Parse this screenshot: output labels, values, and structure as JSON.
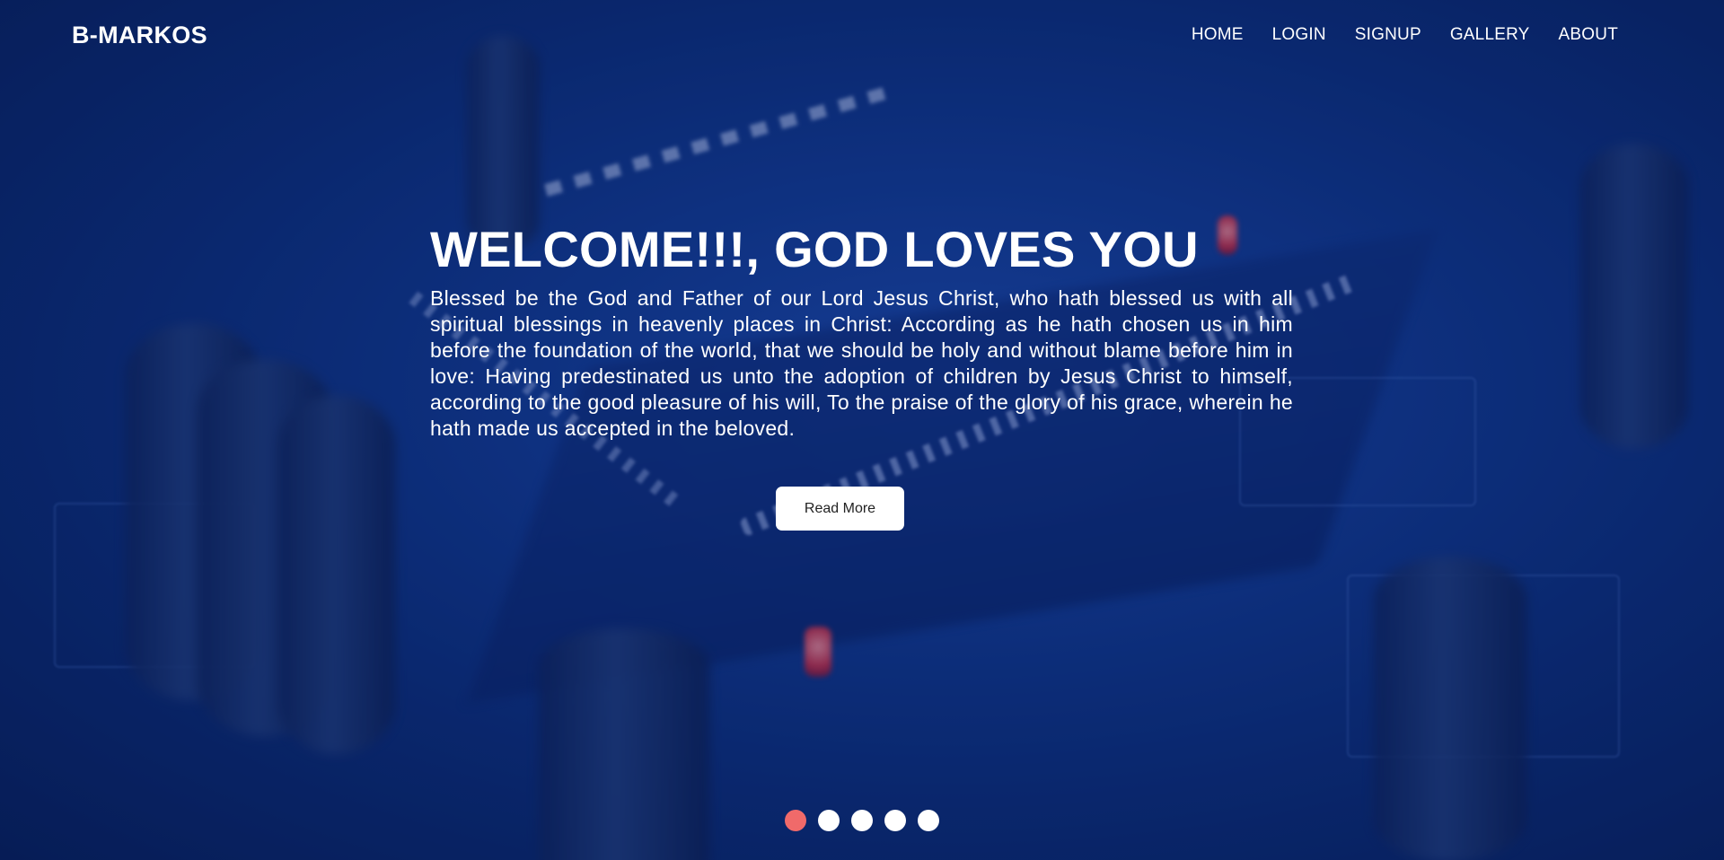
{
  "brand": "B-MARKOS",
  "nav": [
    "HOME",
    "LOGIN",
    "SIGNUP",
    "GALLERY",
    "ABOUT"
  ],
  "hero": {
    "title": "WELCOME!!!, GOD LOVES YOU",
    "text": "Blessed be the God and Father of our Lord Jesus Christ, who hath blessed us with all spiritual blessings in heavenly places in Christ: According as he hath chosen us in him before the foundation of the world, that we should be holy and without blame before him in love: Having predestinated us unto the adoption of children by Jesus Christ to himself, according to the good pleasure of his will, To the praise of the glory of his grace, wherein he hath made us accepted in the beloved.",
    "button": "Read More"
  },
  "carousel": {
    "slides": 5,
    "active_index": 0
  },
  "colors": {
    "active_dot": "#f06a6a",
    "inactive_dot": "#ffffff",
    "overlay": "#0c2a6b"
  },
  "background": "circuit-board-image"
}
